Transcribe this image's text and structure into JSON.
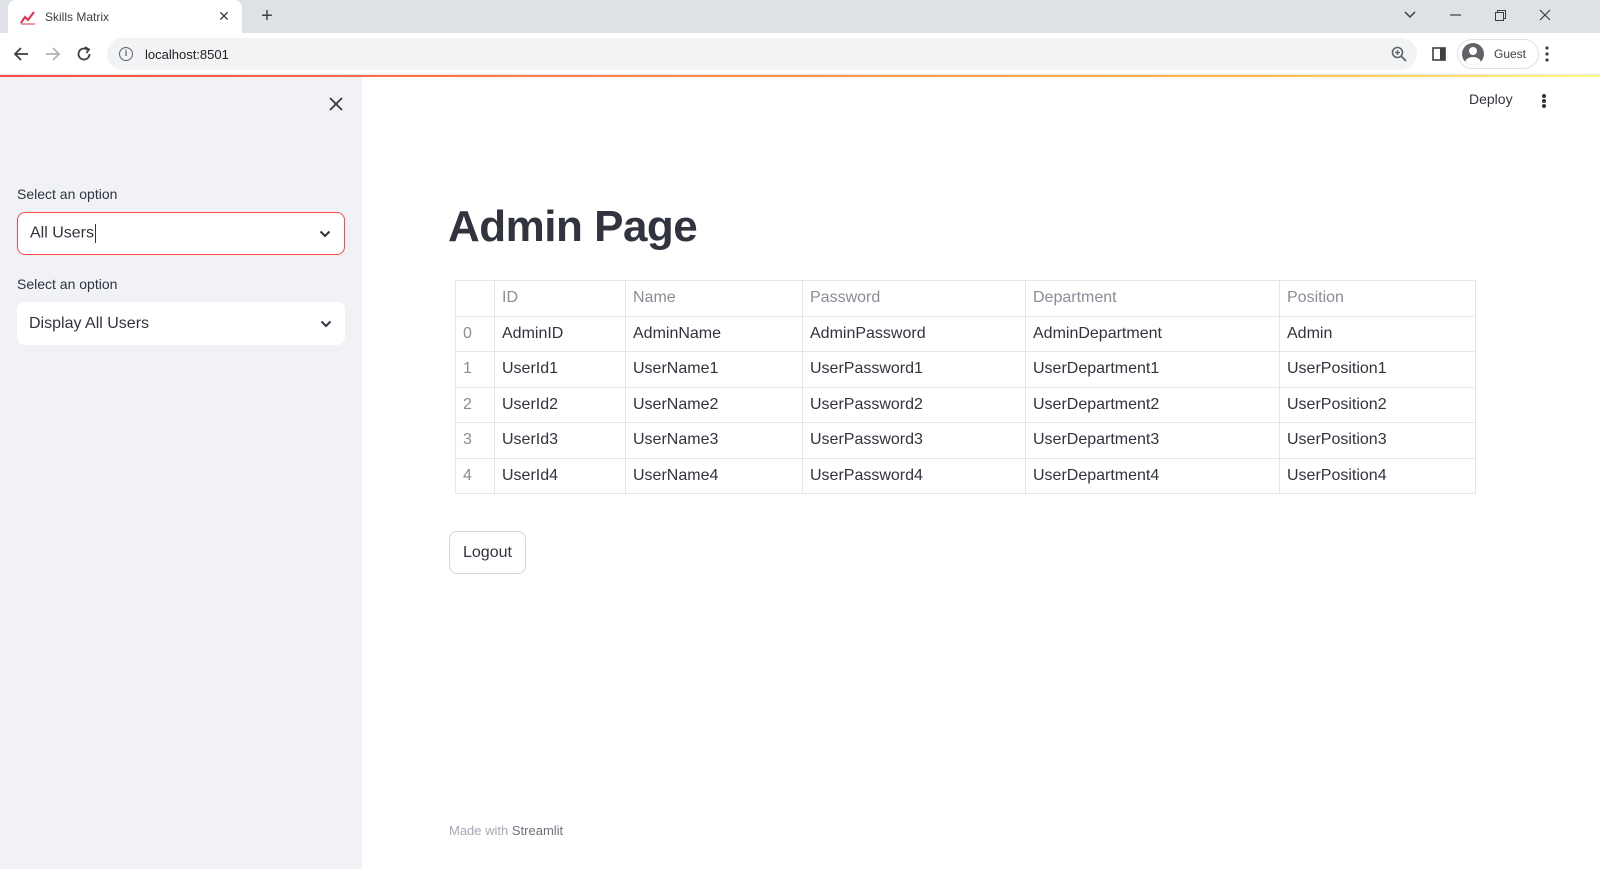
{
  "browser": {
    "tab_title": "Skills Matrix",
    "url": "localhost:8501",
    "profile_label": "Guest"
  },
  "sidebar": {
    "select1": {
      "label": "Select an option",
      "value": "All Users"
    },
    "select2": {
      "label": "Select an option",
      "value": "Display All Users"
    }
  },
  "header": {
    "deploy_label": "Deploy"
  },
  "main": {
    "title": "Admin Page",
    "table": {
      "columns": [
        "ID",
        "Name",
        "Password",
        "Department",
        "Position"
      ],
      "rows": [
        {
          "index": "0",
          "cells": [
            "AdminID",
            "AdminName",
            "AdminPassword",
            "AdminDepartment",
            "Admin"
          ]
        },
        {
          "index": "1",
          "cells": [
            "UserId1",
            "UserName1",
            "UserPassword1",
            "UserDepartment1",
            "UserPosition1"
          ]
        },
        {
          "index": "2",
          "cells": [
            "UserId2",
            "UserName2",
            "UserPassword2",
            "UserDepartment2",
            "UserPosition2"
          ]
        },
        {
          "index": "3",
          "cells": [
            "UserId3",
            "UserName3",
            "UserPassword3",
            "UserDepartment3",
            "UserPosition3"
          ]
        },
        {
          "index": "4",
          "cells": [
            "UserId4",
            "UserName4",
            "UserPassword4",
            "UserDepartment4",
            "UserPosition4"
          ]
        }
      ]
    },
    "logout_label": "Logout"
  },
  "footer": {
    "prefix": "Made with",
    "brand": "Streamlit"
  },
  "colors": {
    "accent": "#ff4b4b",
    "sidebar_bg": "#f0f2f6",
    "text": "#31333f"
  }
}
